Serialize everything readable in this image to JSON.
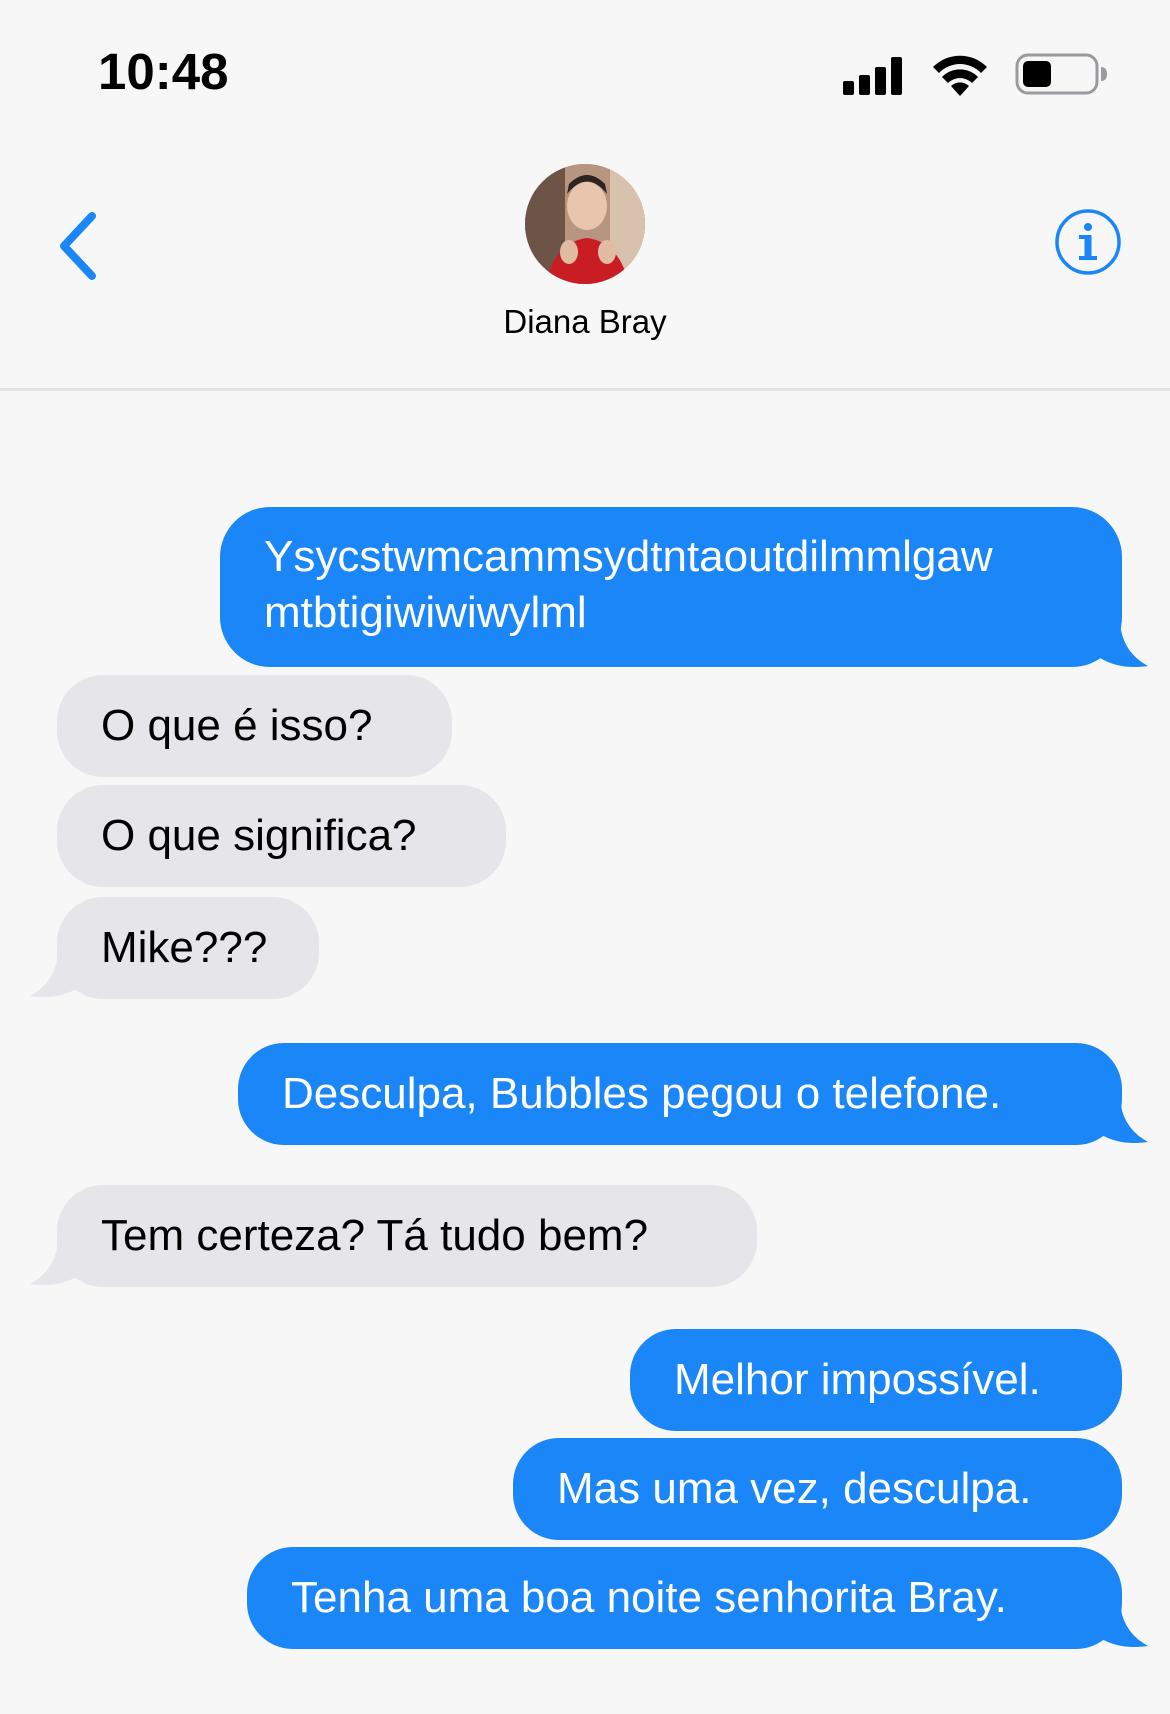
{
  "status_bar": {
    "time": "10:48",
    "icons": [
      "signal-icon",
      "wifi-icon",
      "battery-icon"
    ]
  },
  "header": {
    "back_icon": "chevron-left-icon",
    "contact_name": "Diana Bray",
    "info_icon": "info-icon"
  },
  "colors": {
    "sent_bubble": "#1a86f7",
    "received_bubble": "#e5e5ea",
    "accent": "#1a86f7",
    "background": "#f7f7f8"
  },
  "messages": [
    {
      "direction": "sent",
      "lines": [
        "Ysycstwmcammsydtntaoutdilmmlgaw",
        "mtbtigiwiwiwylml"
      ]
    },
    {
      "direction": "received",
      "text": "O que é isso?"
    },
    {
      "direction": "received",
      "text": "O que significa?"
    },
    {
      "direction": "received",
      "text": "Mike???"
    },
    {
      "direction": "sent",
      "text": "Desculpa, Bubbles pegou o telefone."
    },
    {
      "direction": "received",
      "text": "Tem certeza? Tá tudo bem?"
    },
    {
      "direction": "sent",
      "text": "Melhor impossível."
    },
    {
      "direction": "sent",
      "text": "Mas uma vez, desculpa."
    },
    {
      "direction": "sent",
      "text": "Tenha uma boa noite senhorita Bray."
    }
  ]
}
